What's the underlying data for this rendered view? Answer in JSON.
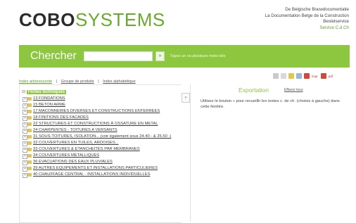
{
  "header": {
    "logo_bold": "COBO",
    "logo_light": "SYSTEMS",
    "lines": [
      "De Belgische Bouwdocumentatie",
      "La Documentation Belge de la Construction",
      "Bestelservice"
    ],
    "service_line": "Service C.d.Ch"
  },
  "search": {
    "label": "Chercher",
    "value": "",
    "go_label": "»",
    "help_text": "Tapez un ou plusieurs mots-clés"
  },
  "tabs": {
    "items": [
      "Index arborescente",
      "|",
      "Groupe de produits",
      "|",
      "Index alphabétique"
    ]
  },
  "toolbar": {
    "icons": [
      "print-icon",
      "font-icon",
      "bookmark-icon",
      "mail-icon",
      "pdf-icon"
    ],
    "text_a": "impr.",
    "text_b": "pdf"
  },
  "tree": {
    "root": "Fiches techniques",
    "items": [
      "13 FONDATIONS",
      "15 BETON ARME",
      "17 MACONNERIES DIVERSES ET CONSTRUCTIONS ENTERREES",
      "18 FINITIONS DES FACADES",
      "22 STRUCTURES ET CONSTRUCTIONS À OSSATURE EN METAL",
      "24 CHARPENTES - TOITURES A VERSANTS",
      "31 SOUS-TOITURES, ISOLATION... (voir également sous 24.40 - & 25.50 -)",
      "32 COUVERTURES EN TUILES, ARDOISES...",
      "33 COUVERTURES & ETANCHEITÉS PAR MEMBRANES",
      "34 COUVERTURES METALLIQUES",
      "36 EVACUATIONS DES EAUX PLUVIALES",
      "39 AUTRES EQUIPEMENTS ET INSTALLATIONS PARTICULIERES",
      "40 CHAUFFAGE CENTRAL - INSTALLATIONS INDIVIDUELLES"
    ]
  },
  "splitter": {
    "label": "»"
  },
  "export": {
    "title": "Exportation",
    "clear": "Effacer tous",
    "help": "Utilisez le bouton » pour recueillir les textes c. de ch. (choisis à gauche) dans cette fenêtre."
  },
  "colors": {
    "accent": "#8dc63f",
    "logo_dark": "#2b2b2b",
    "logo_green": "#6aaa2a"
  }
}
